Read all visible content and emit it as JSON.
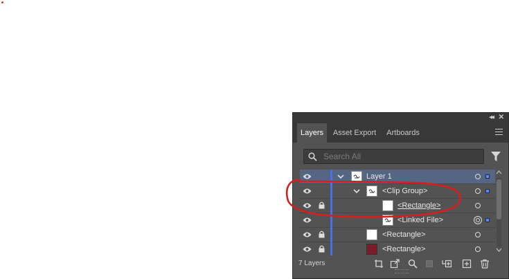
{
  "panel": {
    "tabs": [
      {
        "label": "Layers",
        "active": true
      },
      {
        "label": "Asset Export",
        "active": false
      },
      {
        "label": "Artboards",
        "active": false
      }
    ],
    "search": {
      "placeholder": "Search All",
      "value": ""
    },
    "layers": [
      {
        "name": "Layer 1",
        "selected": true,
        "expanded": true,
        "locked": false,
        "thumb": "artwork"
      },
      {
        "name": "<Clip Group>",
        "selected": false,
        "expanded": true,
        "locked": false,
        "thumb": "artwork"
      },
      {
        "name": "<Rectangle>",
        "selected": false,
        "locked": true,
        "thumb": "white",
        "underlined": true
      },
      {
        "name": "<Linked File>",
        "selected": false,
        "locked": false,
        "thumb": "artwork"
      },
      {
        "name": "<Rectangle>",
        "selected": false,
        "locked": true,
        "thumb": "white"
      },
      {
        "name": "<Rectangle>",
        "selected": false,
        "locked": true,
        "thumb": "dark"
      }
    ],
    "footer": {
      "count_label": "7 Layers"
    },
    "colors": {
      "panel_bg": "#535353",
      "selected_row": "#556683",
      "layer_color": "#4d6fe6",
      "annotation": "#d61f1f",
      "dark_thumb": "#7b1c2d"
    },
    "icons": [
      "collapse-icon",
      "close-icon",
      "panel-menu-icon",
      "search-icon",
      "filter-icon",
      "eye-icon",
      "lock-icon",
      "chevron-down-icon",
      "target-icon",
      "locate-object-icon",
      "make-clipping-mask-icon",
      "search-layer-icon",
      "collect-for-export-icon",
      "create-sublayer-icon",
      "create-new-layer-icon",
      "delete-icon"
    ]
  }
}
